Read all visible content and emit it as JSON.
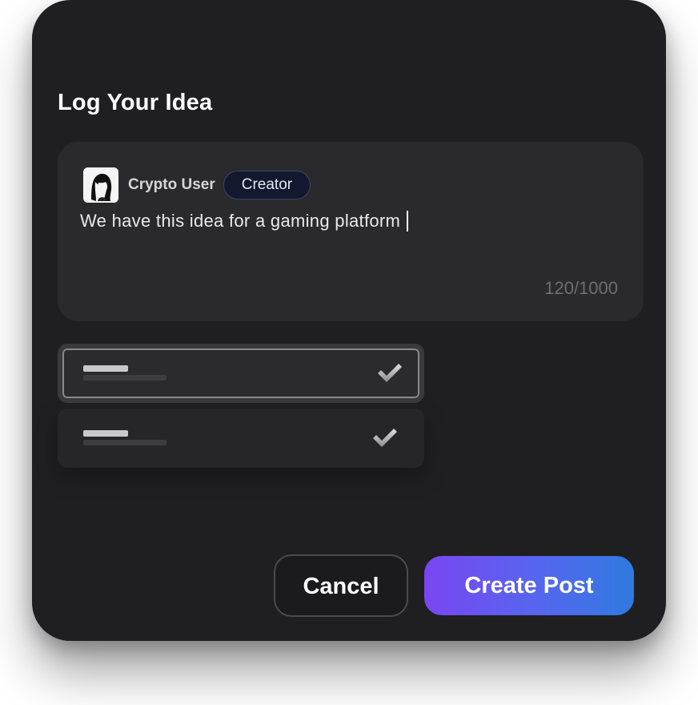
{
  "modal": {
    "title": "Log Your Idea"
  },
  "composer": {
    "author_name": "Crypto User",
    "role_badge": "Creator",
    "text": "We have this idea for a gaming platform",
    "char_count": "120/1000"
  },
  "options": [
    {
      "selected": true,
      "checked": true,
      "icon": "check-icon"
    },
    {
      "selected": false,
      "checked": true,
      "icon": "check-icon"
    }
  ],
  "actions": {
    "cancel_label": "Cancel",
    "create_label": "Create Post"
  },
  "colors": {
    "modal_bg": "#1f1f21",
    "composer_bg": "#2a2a2d",
    "badge_bg": "#14182e",
    "gradient_start": "#7a46f2",
    "gradient_end": "#2f7ae0"
  }
}
